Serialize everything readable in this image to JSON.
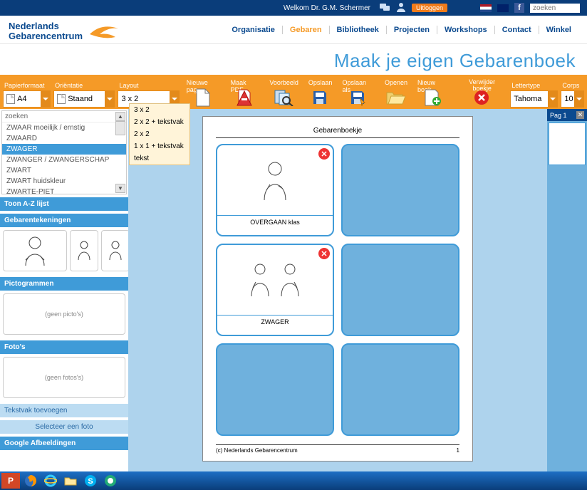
{
  "topbar": {
    "welkom": "Welkom Dr. G.M. Schermer",
    "logout": "Uitloggen",
    "search_placeholder": "zoeken"
  },
  "brand": {
    "line1": "Nederlands",
    "line2": "Gebarencentrum"
  },
  "nav": {
    "items": [
      "Organisatie",
      "Gebaren",
      "Bibliotheek",
      "Projecten",
      "Workshops",
      "Contact",
      "Winkel"
    ],
    "active_index": 1
  },
  "page_title": "Maak je eigen Gebarenboek",
  "toolbar": {
    "papierformaat_label": "Papierformaat",
    "papierformaat_value": "A4",
    "orientatie_label": "Oriëntatie",
    "orientatie_value": "Staand",
    "layout_label": "Layout",
    "layout_value": "3 x 2",
    "layout_options": [
      "3 x 2",
      "2 x 2 + tekstvak",
      "2 x 2",
      "1 x 1 + tekstvak",
      "tekst"
    ],
    "nieuwe_pag": "Nieuwe pag.",
    "maak_pdf": "Maak PDF",
    "voorbeeld": "Voorbeeld",
    "opslaan": "Opslaan",
    "opslaan_als": "Opslaan als",
    "openen": "Openen",
    "nieuw_boek": "Nieuw boek",
    "verwijder_boekje": "Verwijder boekje",
    "lettertype_label": "Lettertype",
    "lettertype_value": "Tahoma",
    "corps_label": "Corps",
    "corps_value": "10"
  },
  "wordlist": {
    "header": "zoeken",
    "items": [
      "ZWAAR moeilijk / ernstig",
      "ZWAARD",
      "ZWAGER",
      "ZWANGER / ZWANGERSCHAP",
      "ZWART",
      "ZWART huidskleur",
      "ZWARTE-PIET"
    ],
    "selected_index": 2
  },
  "panels": {
    "toon_az": "Toon A-Z lijst",
    "gebarentekeningen": "Gebarentekeningen",
    "pictogrammen": "Pictogrammen",
    "geen_pictos": "(geen picto's)",
    "fotos": "Foto's",
    "geen_fotos": "(geen fotos's)",
    "tekstvak_toevoegen": "Tekstvak toevoegen",
    "selecteer_foto": "Selecteer een foto",
    "google_afbeeldingen": "Google Afbeeldingen"
  },
  "book": {
    "title": "Gebarenboekje",
    "cells": [
      {
        "label": "OVERGAAN klas",
        "filled": true
      },
      {
        "filled": false
      },
      {
        "label": "ZWAGER",
        "filled": true
      },
      {
        "filled": false
      },
      {
        "filled": false
      },
      {
        "filled": false
      }
    ],
    "footer_left": "(c) Nederlands Gebarencentrum",
    "footer_right": "1"
  },
  "rightbar": {
    "pag_label": "Pag 1"
  }
}
